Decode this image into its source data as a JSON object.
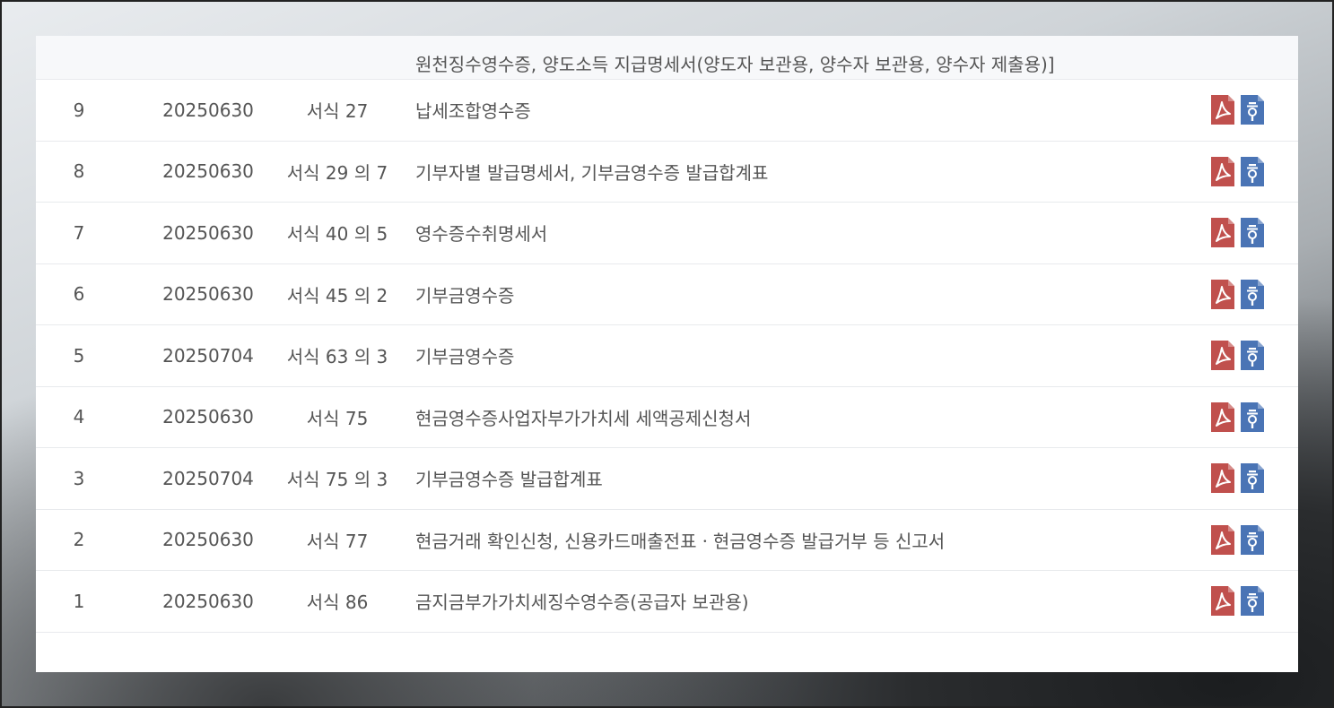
{
  "top_row": {
    "title": "원천징수영수증, 양도소득 지급명세서(양도자 보관용, 양수자 보관용, 양수자 제출용)]"
  },
  "rows": [
    {
      "no": "9",
      "date": "20250630",
      "form": "서식 27",
      "title": "납세조합영수증",
      "icons": [
        "pdf-icon",
        "hwp-icon"
      ]
    },
    {
      "no": "8",
      "date": "20250630",
      "form": "서식 29 의 7",
      "title": "기부자별 발급명세서, 기부금영수증 발급합계표",
      "icons": [
        "pdf-icon",
        "hwp-icon"
      ]
    },
    {
      "no": "7",
      "date": "20250630",
      "form": "서식 40 의 5",
      "title": "영수증수취명세서",
      "icons": [
        "pdf-icon",
        "hwp-icon"
      ]
    },
    {
      "no": "6",
      "date": "20250630",
      "form": "서식 45 의 2",
      "title": "기부금영수증",
      "icons": [
        "pdf-icon",
        "hwp-icon"
      ]
    },
    {
      "no": "5",
      "date": "20250704",
      "form": "서식 63 의 3",
      "title": "기부금영수증",
      "icons": [
        "pdf-icon",
        "hwp-icon"
      ]
    },
    {
      "no": "4",
      "date": "20250630",
      "form": "서식 75",
      "title": "현금영수증사업자부가가치세 세액공제신청서",
      "icons": [
        "pdf-icon",
        "hwp-icon"
      ]
    },
    {
      "no": "3",
      "date": "20250704",
      "form": "서식 75 의 3",
      "title": "기부금영수증 발급합계표",
      "icons": [
        "pdf-icon",
        "hwp-icon"
      ]
    },
    {
      "no": "2",
      "date": "20250630",
      "form": "서식 77",
      "title": "현금거래 확인신청, 신용카드매출전표ㆍ현금영수증 발급거부 등 신고서",
      "icons": [
        "pdf-icon",
        "hwp-icon"
      ]
    },
    {
      "no": "1",
      "date": "20250630",
      "form": "서식 86",
      "title": "금지금부가가치세징수영수증(공급자 보관용)",
      "icons": [
        "pdf-icon",
        "hwp-icon"
      ]
    }
  ],
  "colors": {
    "pdf": "#c0504d",
    "hwp": "#4a74b5",
    "text": "#555555",
    "divider": "#e8eaed"
  }
}
